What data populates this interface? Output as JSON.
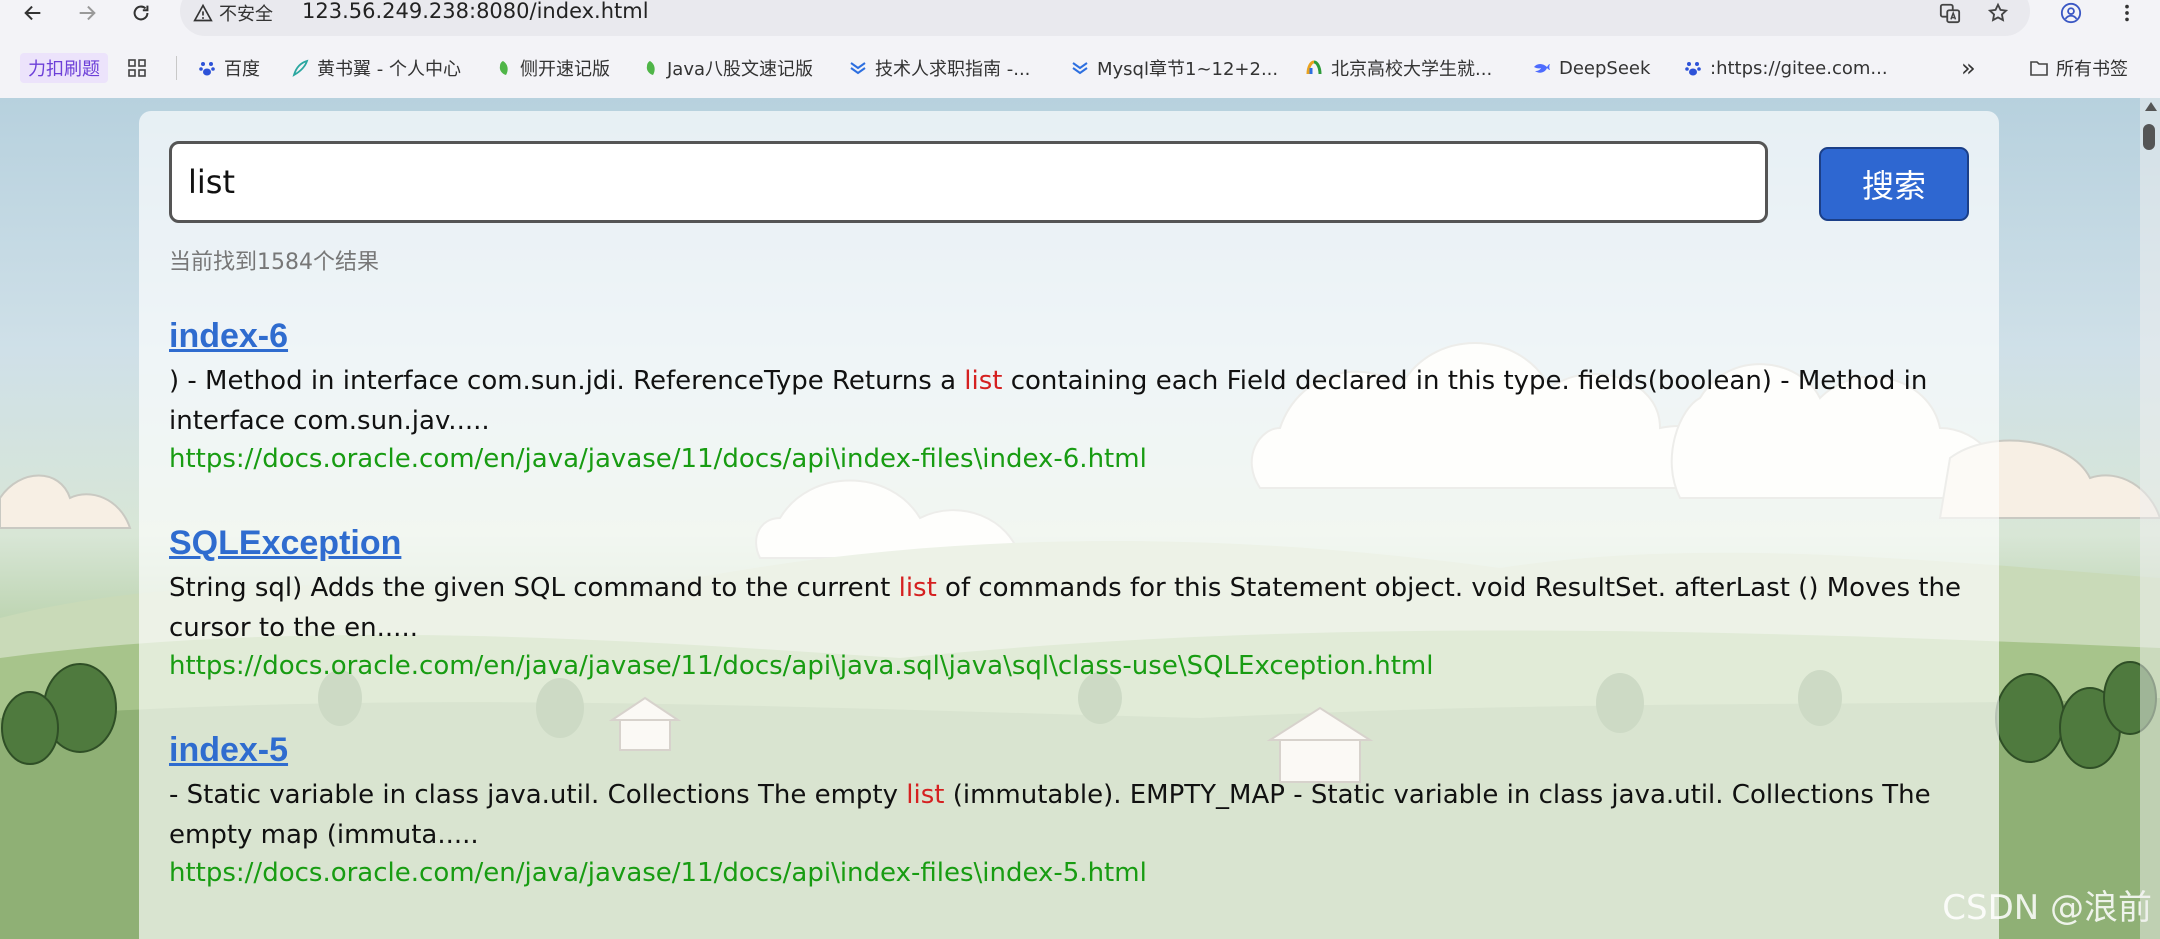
{
  "browser": {
    "insecure_label": "不安全",
    "url": "123.56.249.238:8080/index.html",
    "bookmarks": [
      {
        "label": "力扣刷题"
      },
      {
        "label": "百度"
      },
      {
        "label": "黄书翼 - 个人中心"
      },
      {
        "label": "侧开速记版"
      },
      {
        "label": "Java八股文速记版"
      },
      {
        "label": "技术人求职指南 -..."
      },
      {
        "label": "Mysql章节1~12+2..."
      },
      {
        "label": "北京高校大学生就..."
      },
      {
        "label": "DeepSeek"
      },
      {
        "label": ":https://gitee.com..."
      }
    ],
    "more_bookmarks": "»",
    "all_bookmarks": "所有书签"
  },
  "search": {
    "query": "list",
    "button_label": "搜索",
    "result_count_text": "当前找到1584个结果"
  },
  "results": [
    {
      "title": "index-6",
      "desc_before": ") - Method in interface com.sun.jdi. ReferenceType Returns a ",
      "highlight": "list",
      "desc_after": " containing each Field declared in this type. fields(boolean) - Method in interface com.sun.jav.....",
      "url": "https://docs.oracle.com/en/java/javase/11/docs/api\\index-files\\index-6.html"
    },
    {
      "title": "SQLException",
      "desc_before": "String  sql) Adds the given SQL command to the current ",
      "highlight": "list",
      "desc_after": " of commands for this Statement object. void ResultSet. afterLast () Moves the cursor to the en.....",
      "url": "https://docs.oracle.com/en/java/javase/11/docs/api\\java.sql\\java\\sql\\class-use\\SQLException.html"
    },
    {
      "title": "index-5",
      "desc_before": "- Static variable in class java.util. Collections The empty ",
      "highlight": "list",
      "desc_after": " (immutable). EMPTY_MAP - Static variable in class java.util. Collections The empty map (immuta.....",
      "url": "https://docs.oracle.com/en/java/javase/11/docs/api\\index-files\\index-5.html"
    }
  ],
  "watermark": "CSDN @浪前",
  "colors": {
    "title_link": "#2f6ccf",
    "highlight": "#d52020",
    "url_green": "#189c12",
    "search_button": "#2e67d1"
  }
}
